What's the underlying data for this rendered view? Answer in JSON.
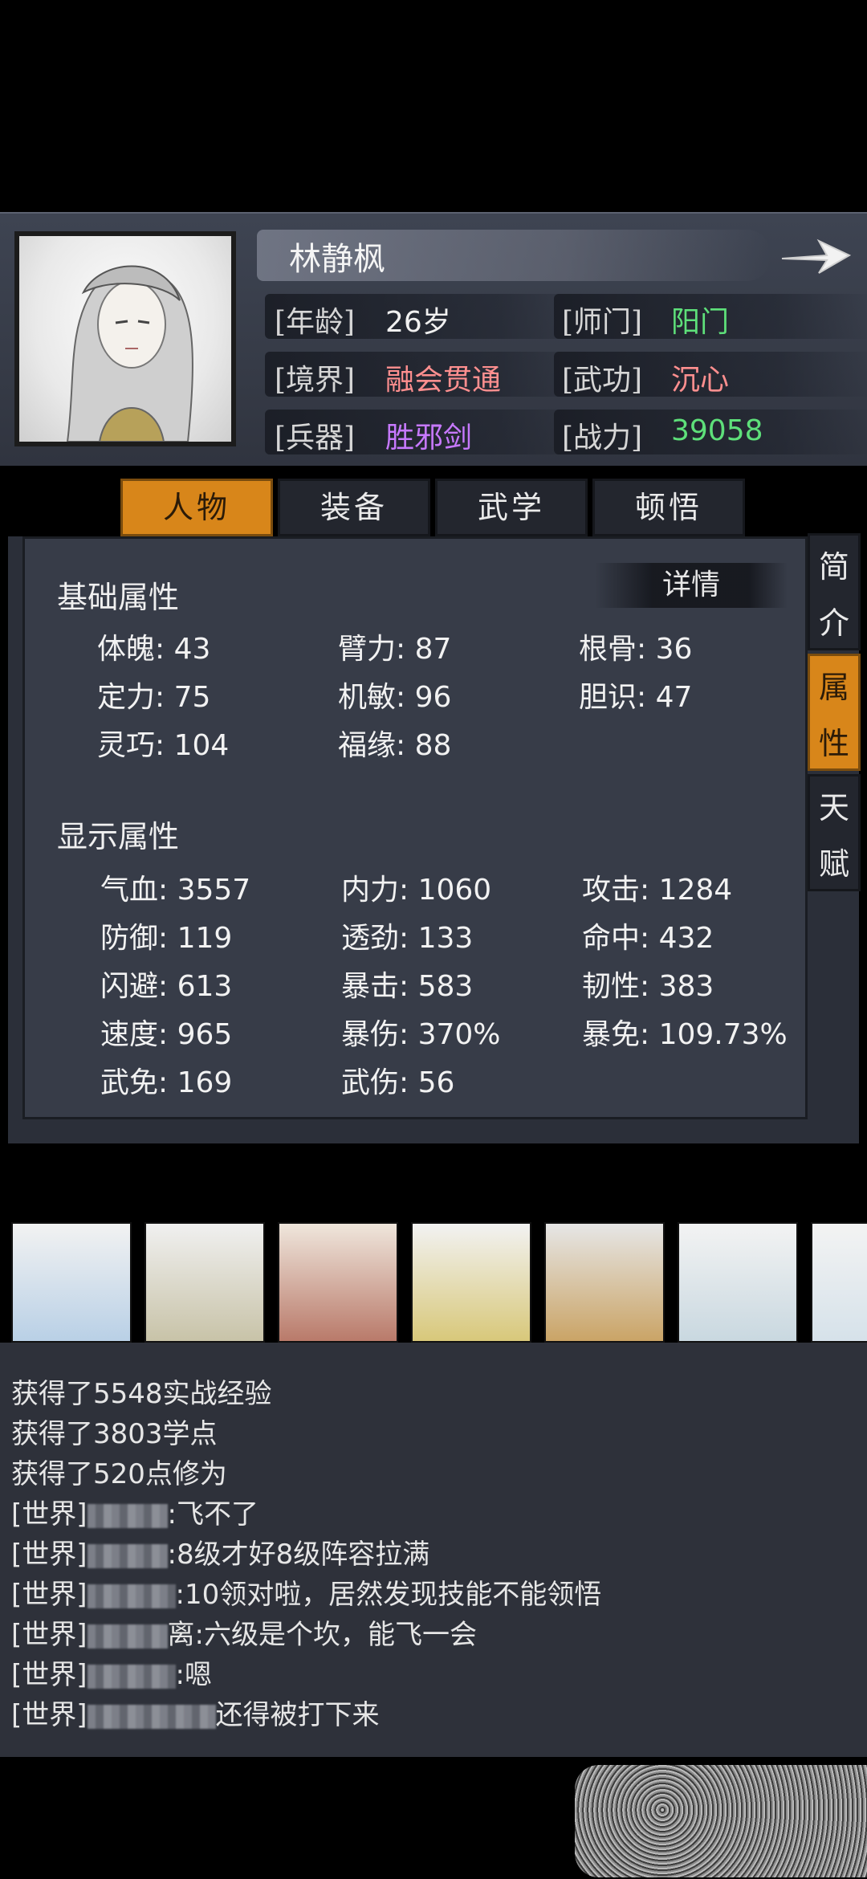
{
  "character": {
    "name": "林静枫",
    "age_label": "[年龄]",
    "age": "26岁",
    "sect_label": "[师门]",
    "sect": "阳门",
    "realm_label": "[境界]",
    "realm": "融会贯通",
    "skill_label": "[武功]",
    "skill": "沉心",
    "weapon_label": "[兵器]",
    "weapon": "胜邪剑",
    "power_label": "[战力]",
    "power": "39058"
  },
  "colors": {
    "sect": "#5ee07a",
    "realm": "#ff8f8f",
    "skill": "#ff8f8f",
    "weapon": "#c779ff",
    "power": "#5ee07a",
    "accent": "#d8861a"
  },
  "tabs": [
    "人物",
    "装备",
    "武学",
    "顿悟"
  ],
  "side_tabs": [
    "简介",
    "属性",
    "天赋"
  ],
  "detail_label": "详情",
  "basic": {
    "title": "基础属性",
    "stats": [
      "体魄: 43",
      "臂力: 87",
      "根骨: 36",
      "定力: 75",
      "机敏: 96",
      "胆识: 47",
      "灵巧: 104",
      "福缘: 88"
    ]
  },
  "display": {
    "title": "显示属性",
    "stats": [
      "气血: 3557",
      "内力: 1060",
      "攻击: 1284",
      "防御: 119",
      "透劲: 133",
      "命中: 432",
      "闪避: 613",
      "暴击: 583",
      "韧性: 383",
      "速度: 965",
      "暴伤: 370%",
      "暴免: 109.73%",
      "武免: 169",
      "武伤: 56"
    ]
  },
  "chat": {
    "lines": [
      {
        "prefix": "获得了5548实战经验",
        "suffix": ""
      },
      {
        "prefix": "获得了3803学点",
        "suffix": ""
      },
      {
        "prefix": "获得了520点修为",
        "suffix": ""
      },
      {
        "prefix": "[世界]",
        "suffix": ":飞不了"
      },
      {
        "prefix": "[世界]",
        "suffix": ":8级才好8级阵容拉满"
      },
      {
        "prefix": "[世界]",
        "suffix": ":10领对啦，居然发现技能不能领悟"
      },
      {
        "prefix": "[世界]",
        "suffix": "离:六级是个坎，能飞一会"
      },
      {
        "prefix": "[世界]",
        "suffix": ":嗯"
      },
      {
        "prefix": "[世界]",
        "suffix": "还得被打下来"
      }
    ]
  }
}
